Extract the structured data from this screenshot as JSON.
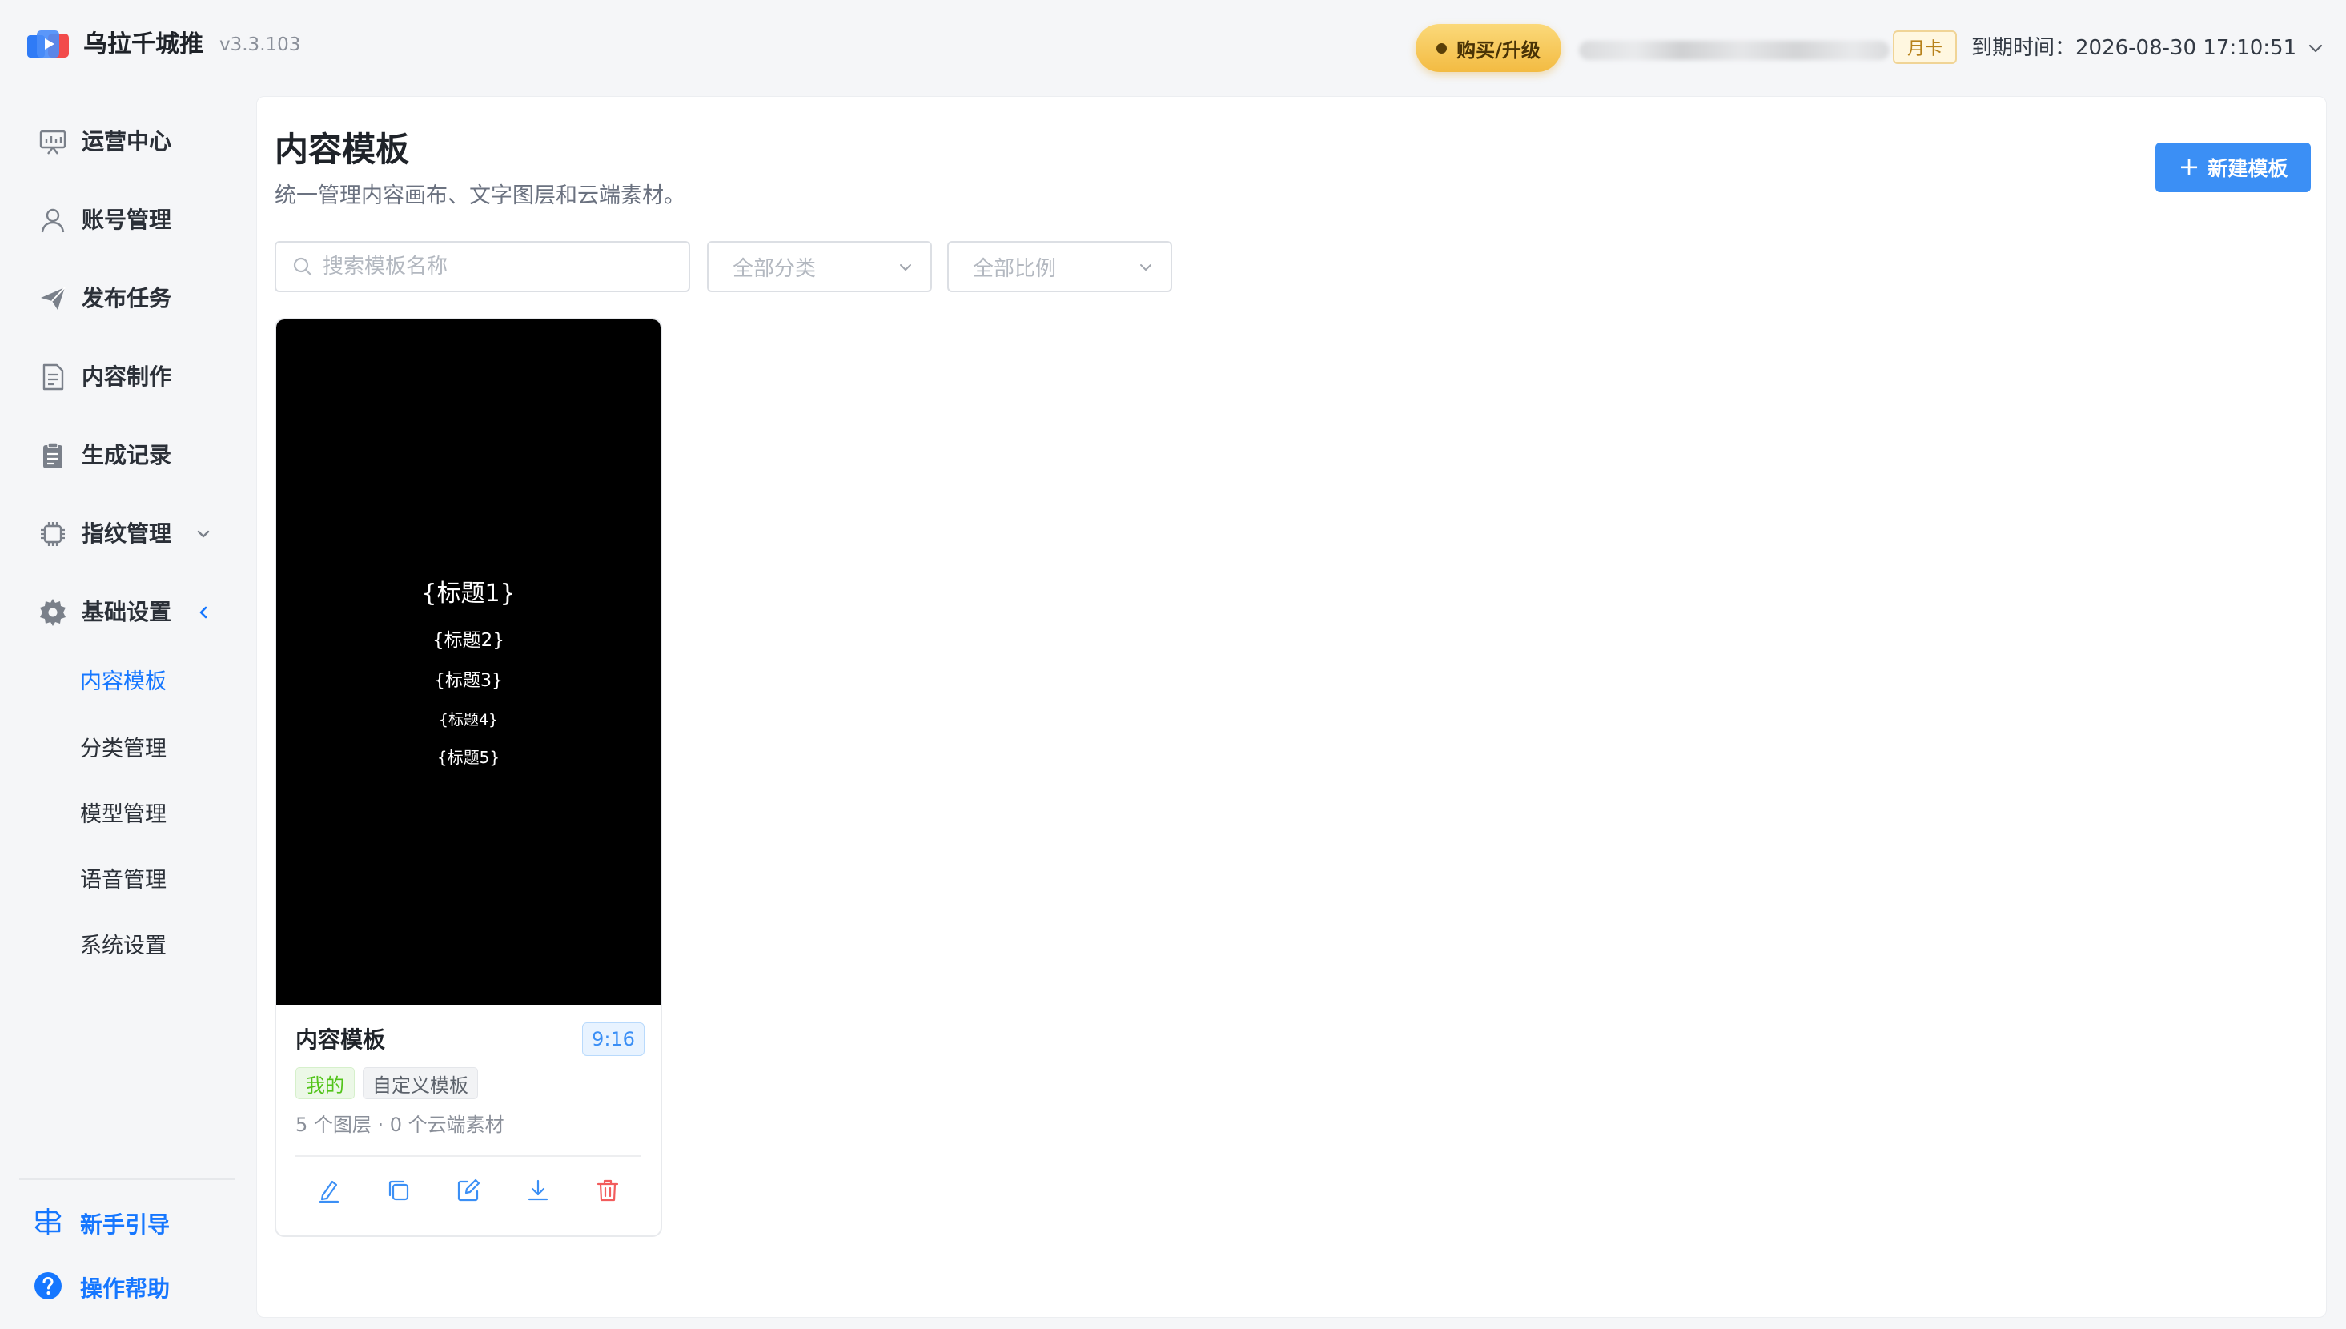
{
  "app": {
    "name": "乌拉千城推",
    "version": "v3.3.103",
    "icon": "app-logo-icon"
  },
  "header": {
    "buy_label": "购买/升级",
    "plan_label": "月卡",
    "expire_text": "到期时间：2026-08-30 17:10:51",
    "user_info": "",
    "colors": {
      "buy_gold": "#f3bb42",
      "plan_border": "#f0d496"
    }
  },
  "sidebar": {
    "items": [
      {
        "label": "运营中心",
        "icon": "monitor-chart-icon"
      },
      {
        "label": "账号管理",
        "icon": "user-icon"
      },
      {
        "label": "发布任务",
        "icon": "paper-plane-icon"
      },
      {
        "label": "内容制作",
        "icon": "document-icon"
      },
      {
        "label": "生成记录",
        "icon": "clipboard-icon"
      },
      {
        "label": "指纹管理",
        "icon": "chip-icon"
      },
      {
        "label": "基础设置",
        "icon": "gear-icon"
      }
    ],
    "subitems": [
      {
        "label": "内容模板",
        "active": true
      },
      {
        "label": "分类管理"
      },
      {
        "label": "模型管理"
      },
      {
        "label": "语音管理"
      },
      {
        "label": "系统设置"
      }
    ],
    "footer": [
      {
        "label": "新手引导",
        "icon": "guide-signpost-icon"
      },
      {
        "label": "操作帮助",
        "icon": "question-circle-icon"
      }
    ]
  },
  "main": {
    "title": "内容模板",
    "subtitle": "统一管理内容画布、文字图层和云端素材。",
    "new_button_label": "新建模板",
    "search": {
      "placeholder": "搜索模板名称",
      "value": ""
    },
    "filters": {
      "category": "全部分类",
      "ratio": "全部比例"
    },
    "accent_color": "#3b8ff5"
  },
  "templates": [
    {
      "name": "内容模板",
      "ratio": "9:16",
      "tags": [
        "我的",
        "自定义模板"
      ],
      "meta": "5 个图层 · 0 个云端素材",
      "preview_lines": [
        "{标题1}",
        "{标题2}",
        "{标题3}",
        "{标题4}",
        "{标题5}"
      ],
      "preview_background": "#000000",
      "actions": [
        "edit-pen-icon",
        "copy-icon",
        "edit-square-icon",
        "download-icon",
        "delete-icon"
      ]
    }
  ]
}
